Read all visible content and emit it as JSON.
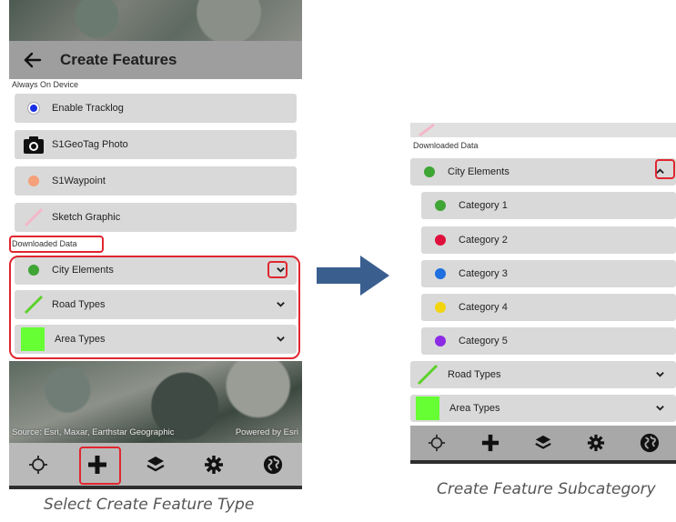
{
  "left_screen": {
    "header": {
      "title": "Create Features"
    },
    "sections": {
      "always_on_device": "Always On Device",
      "downloaded_data": "Downloaded Data"
    },
    "always_items": [
      {
        "label": "Enable Tracklog",
        "icon": "blue-dot-icon",
        "color": "#1a2ee6"
      },
      {
        "label": "S1GeoTag Photo",
        "icon": "camera-icon"
      },
      {
        "label": "S1Waypoint",
        "icon": "orange-dot-icon",
        "color": "#f4a07a"
      },
      {
        "label": "Sketch Graphic",
        "icon": "pink-line-icon",
        "color": "#f3b8c8"
      }
    ],
    "downloaded_items": [
      {
        "label": "City Elements",
        "icon": "green-dot-icon",
        "color": "#3fa535"
      },
      {
        "label": "Road Types",
        "icon": "green-line-icon",
        "color": "#5ad12a"
      },
      {
        "label": "Area Types",
        "icon": "green-square-icon",
        "color": "#66ff33"
      }
    ],
    "map": {
      "source": "Source: Esri, Maxar, Earthstar Geographic",
      "powered": "Powered by Esri"
    },
    "caption": "Select Create Feature Type"
  },
  "right_screen": {
    "sections": {
      "downloaded_data": "Downloaded Data"
    },
    "expanded_group": {
      "label": "City Elements",
      "color": "#3fa535"
    },
    "categories": [
      {
        "label": "Category 1",
        "color": "#3fa535"
      },
      {
        "label": "Category 2",
        "color": "#e0103c"
      },
      {
        "label": "Category 3",
        "color": "#1e6fe0"
      },
      {
        "label": "Category 4",
        "color": "#f2d50f"
      },
      {
        "label": "Category 5",
        "color": "#8c2ae6"
      }
    ],
    "other_groups": [
      {
        "label": "Road Types",
        "color": "#5ad12a"
      },
      {
        "label": "Area Types",
        "color": "#66ff33"
      }
    ],
    "caption": "Create Feature Subcategory"
  },
  "toolbar_icons": [
    "crosshair-icon",
    "add-icon",
    "layers-icon",
    "gear-icon",
    "globe-icon"
  ],
  "colors": {
    "highlight": "#e0262f",
    "arrow": "#3a5f8f"
  }
}
